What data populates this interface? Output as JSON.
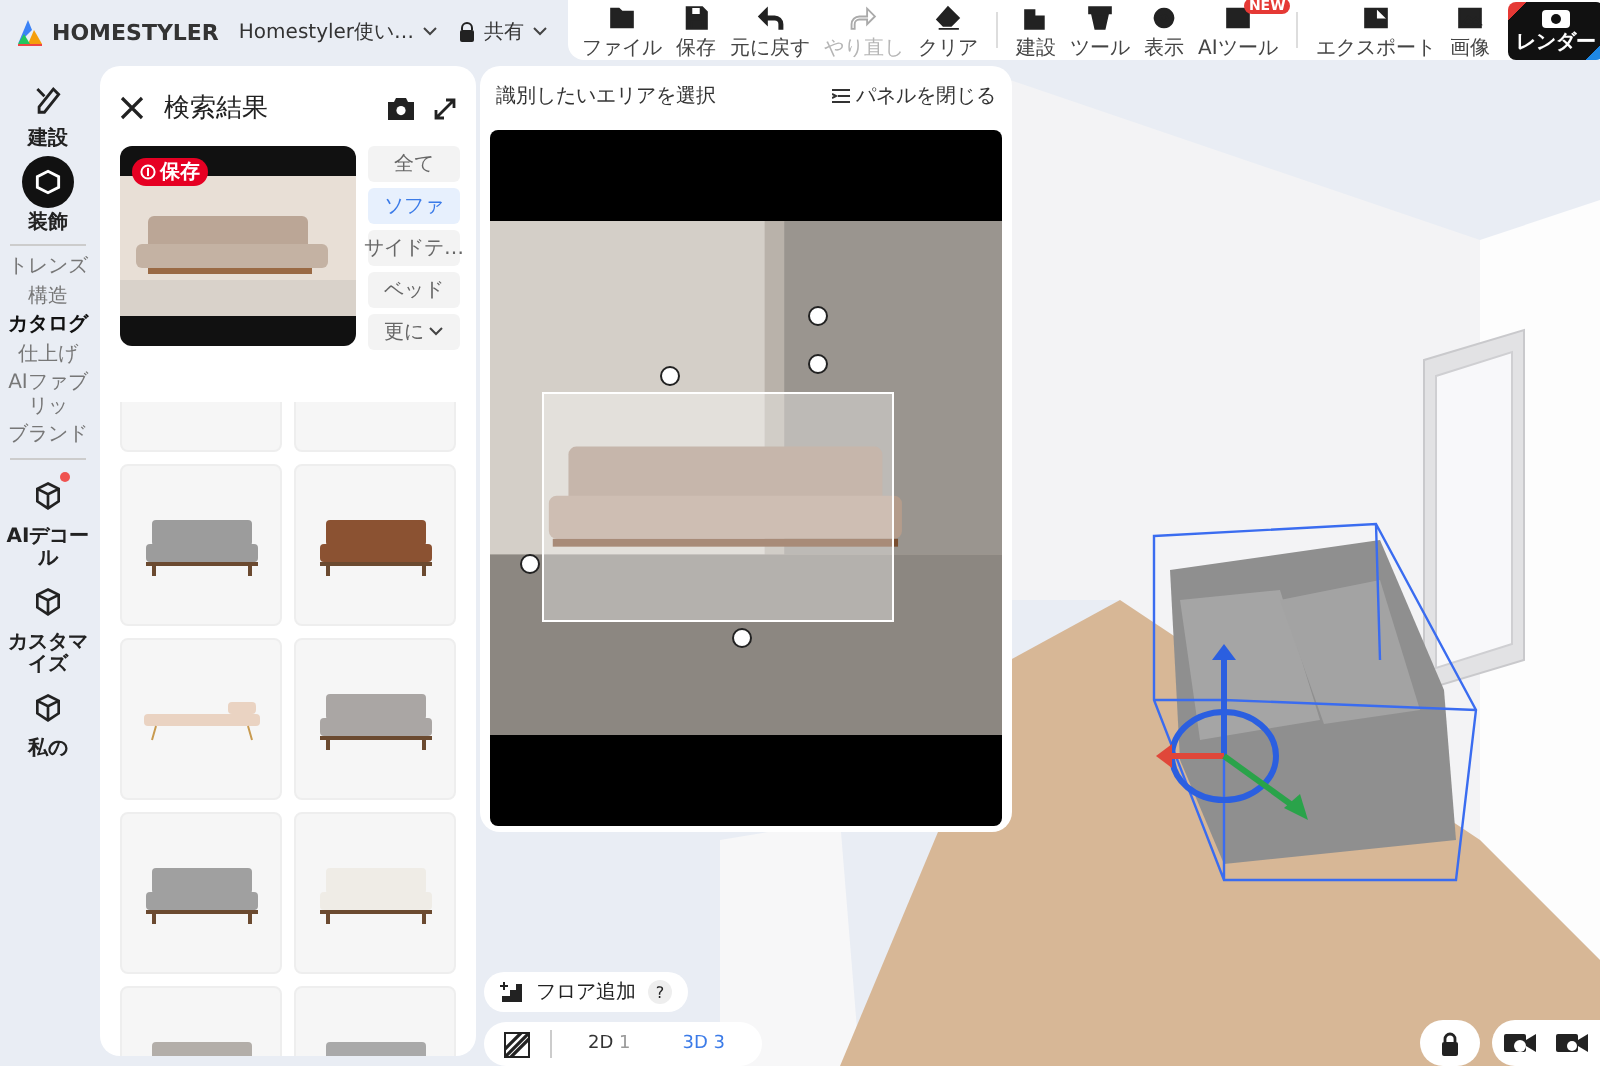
{
  "header": {
    "logo": "HOMESTYLER",
    "project": "Homestyler使い…",
    "share": "共有"
  },
  "toolbar": [
    {
      "items": [
        {
          "label": "ファイル",
          "disabled": false
        },
        {
          "label": "保存",
          "disabled": false
        },
        {
          "label": "元に戻す",
          "disabled": false
        },
        {
          "label": "やり直し",
          "disabled": true
        },
        {
          "label": "クリア",
          "disabled": false
        }
      ]
    },
    {
      "items": [
        {
          "label": "建設",
          "disabled": false
        },
        {
          "label": "ツール",
          "disabled": false
        },
        {
          "label": "表示",
          "disabled": false
        },
        {
          "label": "AIツール",
          "disabled": false,
          "badge": "NEW"
        }
      ]
    },
    {
      "items": [
        {
          "label": "エクスポート",
          "disabled": false
        },
        {
          "label": "画像",
          "disabled": false
        }
      ]
    }
  ],
  "render_button": {
    "label": "レンダー"
  },
  "rail_top": [
    {
      "label": "建設",
      "selected": false
    },
    {
      "label": "装飾",
      "selected": true
    }
  ],
  "catalog_nav": [
    {
      "label": "トレンズ",
      "selected": false
    },
    {
      "label": "構造",
      "selected": false
    },
    {
      "label": "カタログ",
      "selected": true
    },
    {
      "label": "仕上げ",
      "selected": false
    },
    {
      "label": "AIファブリッ",
      "selected": false
    },
    {
      "label": "ブランド",
      "selected": false
    }
  ],
  "rail_bottom": [
    {
      "label": "AIデコール",
      "selected": false,
      "notification": true
    },
    {
      "label": "カスタマイズ",
      "selected": false,
      "notification": false
    },
    {
      "label": "私の",
      "selected": false,
      "notification": false
    }
  ],
  "search_panel": {
    "title": "検索結果",
    "save_badge": "保存",
    "more": "更に",
    "categories": [
      {
        "label": "全て",
        "selected": false
      },
      {
        "label": "ソファ",
        "selected": true
      },
      {
        "label": "サイドテ…",
        "selected": false
      },
      {
        "label": "ベッド",
        "selected": false
      }
    ],
    "results": [
      {
        "kind": "empty"
      },
      {
        "kind": "empty"
      },
      {
        "kind": "sofa",
        "color": "#9c9c9c"
      },
      {
        "kind": "sofa",
        "color": "#8b5232"
      },
      {
        "kind": "daybed",
        "color": "#ead3c2"
      },
      {
        "kind": "sofa",
        "color": "#aaa6a4"
      },
      {
        "kind": "sofa",
        "color": "#a0a0a0"
      },
      {
        "kind": "sofa",
        "color": "#efece6"
      },
      {
        "kind": "sofa",
        "color": "#b3aea9"
      },
      {
        "kind": "sofa",
        "color": "#a9a9a9"
      }
    ]
  },
  "area_panel": {
    "title": "識別したいエリアを選択",
    "close_label": "パネルを閉じる"
  },
  "floor_button": {
    "label": "フロア追加",
    "help": "?"
  },
  "view_switch": [
    {
      "label": "2D",
      "count": "1",
      "selected": false
    },
    {
      "label": "3D",
      "count": "3",
      "selected": true
    }
  ]
}
